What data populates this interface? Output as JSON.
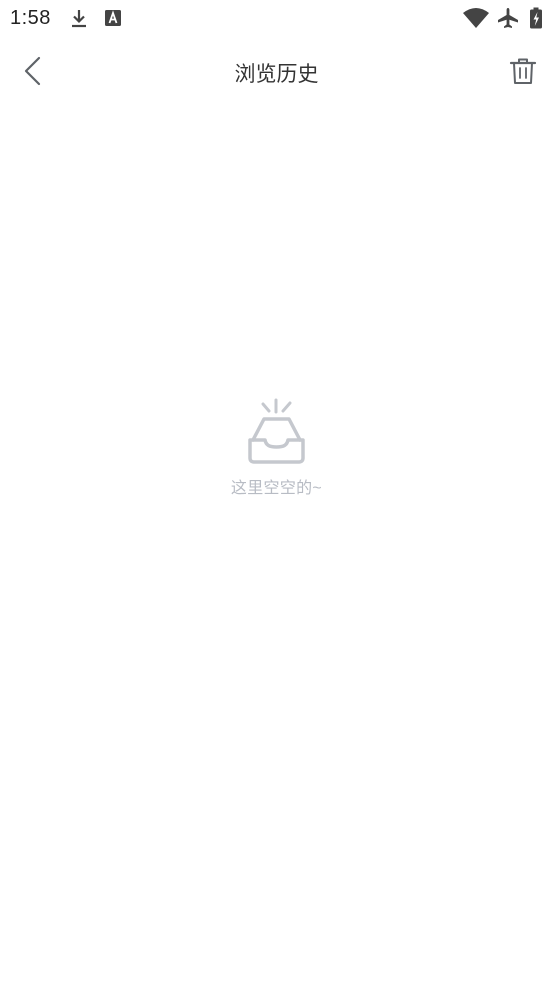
{
  "status_bar": {
    "time": "1:58",
    "icons": [
      "download-icon",
      "font-app-icon",
      "wifi-icon",
      "airplane-mode-icon",
      "battery-charging-icon"
    ]
  },
  "header": {
    "title": "浏览历史",
    "back_icon": "chevron-left-icon",
    "delete_icon": "trash-icon"
  },
  "empty_state": {
    "icon": "empty-inbox-icon",
    "message": "这里空空的~"
  },
  "colors": {
    "icon_gray": "#5f6368",
    "empty_icon": "#c5c8ce",
    "empty_text": "#b8bcc4"
  }
}
